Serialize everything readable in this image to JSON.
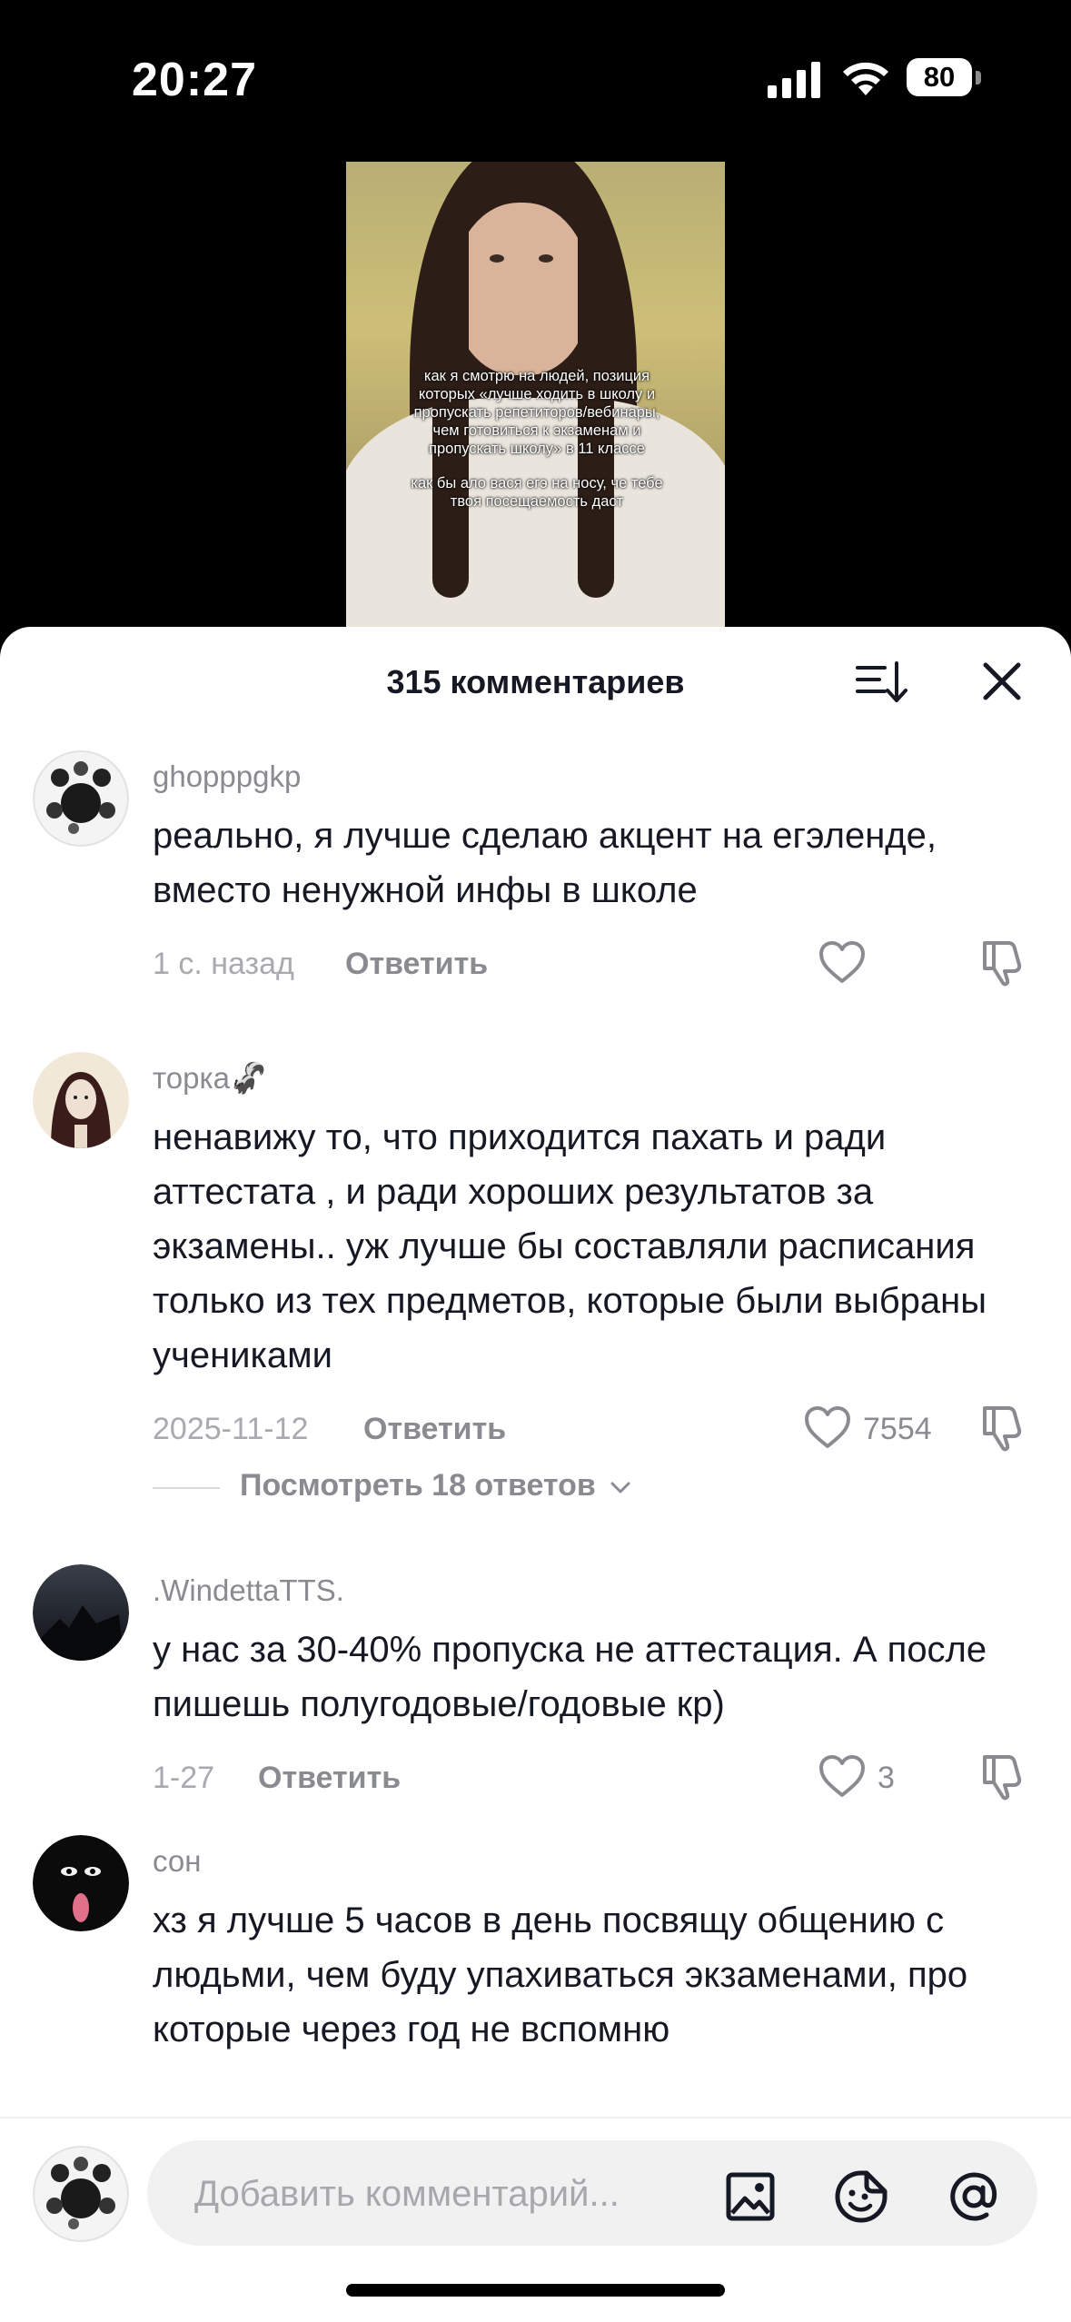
{
  "status_bar": {
    "time": "20:27",
    "battery": "80"
  },
  "video": {
    "overlay_line1": "как я смотрю на людей, позиция которых «лучше ходить в школу и пропускать репетиторов/вебинары, чем готовиться к экзаменам и пропускать школу» в 11 классе",
    "overlay_line2": "как бы ало вася егэ на носу, че тебе твоя посещаемость даст"
  },
  "sheet": {
    "title": "315 комментариев"
  },
  "comments": [
    {
      "username": "ghopppgkp",
      "text": "реально, я лучше сделаю акцент на егэленде, вместо ненужной инфы в школе",
      "time": "1 с. назад",
      "reply_label": "Ответить",
      "likes": ""
    },
    {
      "username": "торка🦨",
      "text": "ненавижу то, что приходится пахать и ради аттестата , и ради хороших результатов за экзамены.. уж лучше бы составляли расписания только из тех предметов, которые были выбраны учениками",
      "time": "2025-11-12",
      "reply_label": "Ответить",
      "likes": "7554",
      "view_replies": "Посмотреть 18 ответов"
    },
    {
      "username": ".WindettaTTS.",
      "text": "у нас за 30-40% пропуска не аттестация. А после пишешь полугодовые/годовые кр)",
      "time": "1-27",
      "reply_label": "Ответить",
      "likes": "3"
    },
    {
      "username": "сон",
      "text": "хз я лучше 5 часов в день посвящу общению с людьми, чем буду упахиваться экзаменами, про которые через год не вспомню",
      "time": "",
      "reply_label": "",
      "likes": ""
    }
  ],
  "input": {
    "placeholder": "Добавить комментарий..."
  },
  "icons": {
    "sort": "sort-icon",
    "close": "close-icon",
    "heart": "heart-icon",
    "dislike": "dislike-icon",
    "image": "image-icon",
    "emoji": "emoji-icon",
    "mention": "at-icon"
  }
}
